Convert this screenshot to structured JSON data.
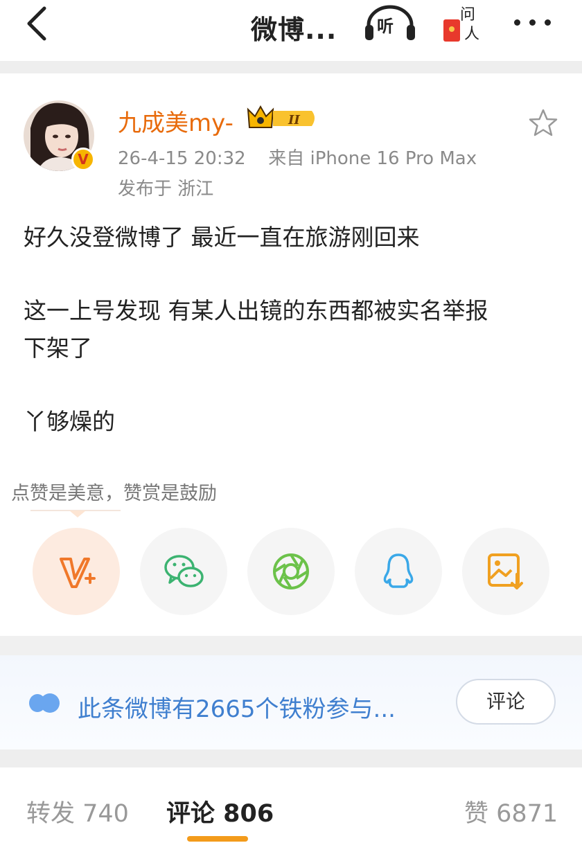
{
  "header": {
    "title": "微博...",
    "listen_label": "听",
    "ask_label": "问人"
  },
  "post": {
    "username": "九成美my-",
    "level_badge": "II",
    "timestamp": "26-4-15 20:32",
    "source": "来自 iPhone 16 Pro Max",
    "location": "发布于 浙江",
    "verified_mark": "V",
    "text": {
      "line1": "好久没登微博了 最近一直在旅游刚回来",
      "line2": "这一上号发现 有某人出镜的东西都被实名举报",
      "line3": "下架了",
      "line4": "丫够燥的"
    }
  },
  "reward_tip": "点赞是美意，赞赏是鼓励",
  "share_icons": [
    "vplus-icon",
    "wechat-icon",
    "moments-icon",
    "qq-icon",
    "save-image-icon"
  ],
  "fan_banner": {
    "text": "此条微博有2665个铁粉参与...",
    "button": "评论"
  },
  "tabs": {
    "repost": "转发 740",
    "comments": "评论 806",
    "likes": "赞 6871"
  },
  "colors": {
    "accent_orange": "#f39b1b",
    "username": "#e86b0c",
    "link_blue": "#3f7fcf"
  }
}
